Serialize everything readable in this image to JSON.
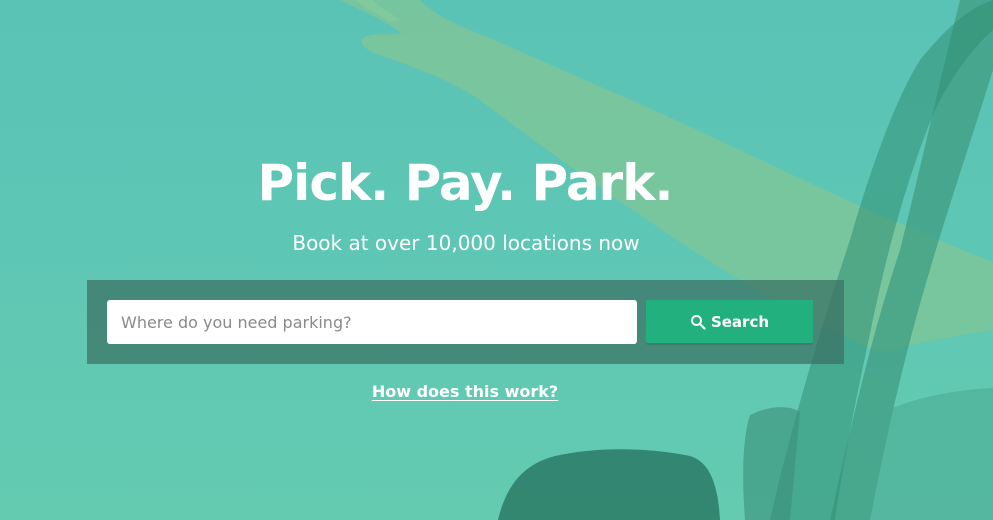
{
  "hero": {
    "headline": "Pick. Pay. Park.",
    "subheadline": "Book at over 10,000 locations now"
  },
  "search": {
    "placeholder": "Where do you need parking?",
    "value": "",
    "button_label": "Search",
    "button_icon": "search-icon"
  },
  "help_link": {
    "label": "How does this work?"
  },
  "colors": {
    "overlay_teal": "#5cc4b3",
    "panel": "#3a7062",
    "button": "#22b07f",
    "text": "#ffffff"
  }
}
